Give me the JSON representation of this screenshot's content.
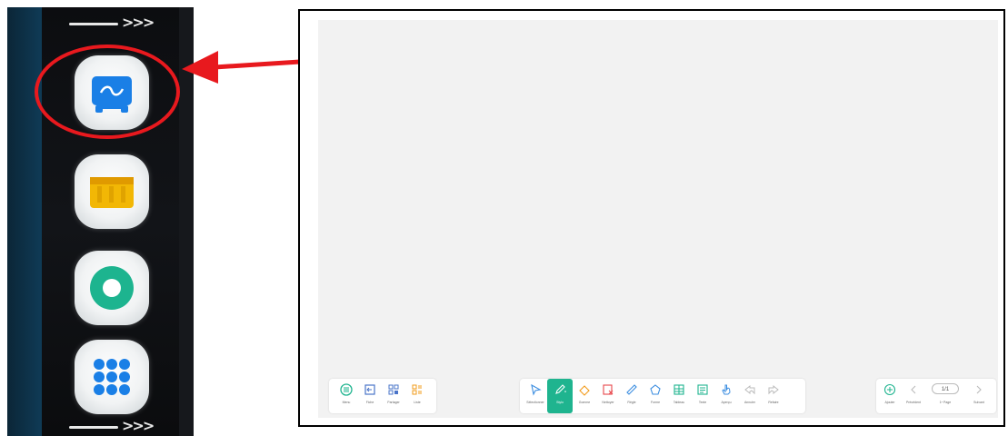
{
  "dock": {
    "swipe_hint_symbol": ">>>",
    "apps": [
      {
        "name": "whiteboard-app",
        "icon": "whiteboard-icon",
        "color": "#1a7fe6"
      },
      {
        "name": "toolbox-app",
        "icon": "toolbox-icon",
        "color": "#f2b705"
      },
      {
        "name": "ring-app",
        "icon": "ring-icon",
        "color": "#1db48f"
      },
      {
        "name": "apps-grid-app",
        "icon": "grid-icon",
        "color": "#1a7fe6"
      }
    ],
    "highlight_color": "#e8191e"
  },
  "whiteboard": {
    "left_tools": [
      {
        "label": "Menu",
        "icon": "menu-icon",
        "color": "#1fb48f"
      },
      {
        "label": "Fiche",
        "icon": "file-icon",
        "color": "#4a74c9"
      },
      {
        "label": "Partager",
        "icon": "share-icon",
        "color": "#4a74c9"
      },
      {
        "label": "Liste",
        "icon": "list-icon",
        "color": "#f29b1a"
      }
    ],
    "center_tools": [
      {
        "label": "Sélectionner",
        "icon": "select-icon",
        "color": "#3b8de0"
      },
      {
        "label": "Stylo",
        "icon": "pen-icon",
        "color": "#ffffff",
        "active": true
      },
      {
        "label": "Gomme",
        "icon": "eraser-icon",
        "color": "#f29b1a"
      },
      {
        "label": "Nettoyer",
        "icon": "clear-icon",
        "color": "#e8474c"
      },
      {
        "label": "Règle",
        "icon": "ruler-icon",
        "color": "#3b8de0"
      },
      {
        "label": "Forme",
        "icon": "shape-icon",
        "color": "#3b8de0"
      },
      {
        "label": "Tableau",
        "icon": "table-icon",
        "color": "#1fb48f"
      },
      {
        "label": "Texte",
        "icon": "text-icon",
        "color": "#1fb48f"
      },
      {
        "label": "Aperçu",
        "icon": "hand-icon",
        "color": "#3b8de0"
      },
      {
        "label": "Annuler",
        "icon": "undo-icon",
        "color": "#bbbbbb"
      },
      {
        "label": "Refaire",
        "icon": "redo-icon",
        "color": "#bbbbbb"
      }
    ],
    "right_tools": {
      "add_label": "Ajouter",
      "prev_label": "Précédent",
      "page_counter": "1/1",
      "page_label": "1ᵉ Page",
      "next_label": "Suivant"
    }
  }
}
